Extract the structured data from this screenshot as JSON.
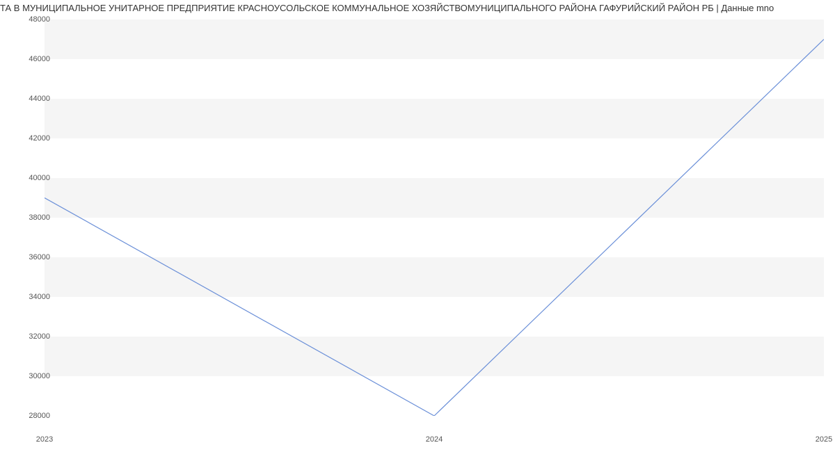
{
  "chart_data": {
    "type": "line",
    "title": "ТА В МУНИЦИПАЛЬНОЕ УНИТАРНОЕ ПРЕДПРИЯТИЕ КРАСНОУСОЛЬСКОЕ КОММУНАЛЬНОЕ ХОЗЯЙСТВОМУНИЦИПАЛЬНОГО РАЙОНА ГАФУРИЙСКИЙ РАЙОН РБ | Данные mno",
    "xlabel": "",
    "ylabel": "",
    "x": [
      "2023",
      "2024",
      "2025"
    ],
    "values": [
      39000,
      28000,
      47000
    ],
    "ylim": [
      28000,
      48000
    ],
    "y_ticks": [
      28000,
      30000,
      32000,
      34000,
      36000,
      38000,
      40000,
      42000,
      44000,
      46000,
      48000
    ]
  }
}
